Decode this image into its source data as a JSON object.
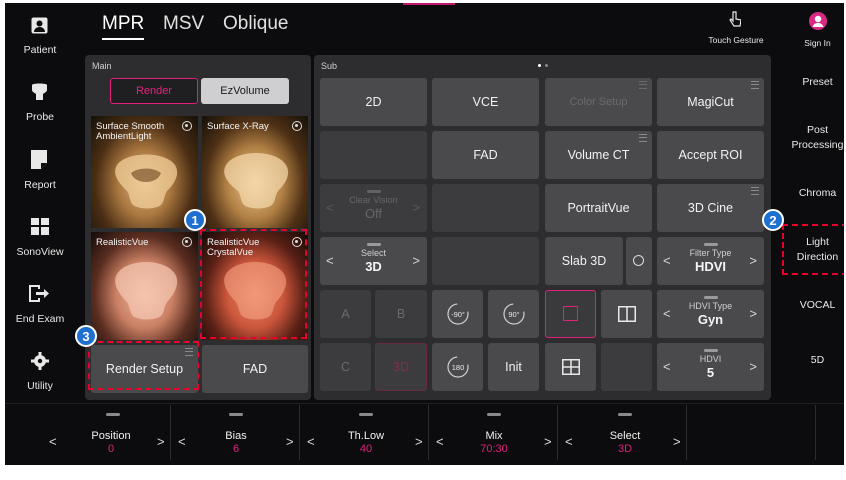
{
  "tabs": [
    "MPR",
    "MSV",
    "Oblique"
  ],
  "left_nav": [
    {
      "label": "Patient",
      "icon": "patient-icon"
    },
    {
      "label": "Probe",
      "icon": "probe-icon"
    },
    {
      "label": "Report",
      "icon": "report-icon"
    },
    {
      "label": "SonoView",
      "icon": "sonoview-icon"
    },
    {
      "label": "End Exam",
      "icon": "end-exam-icon"
    },
    {
      "label": "Utility",
      "icon": "gear-icon"
    }
  ],
  "top_right": {
    "touch_gesture": "Touch Gesture",
    "sign_in": "Sign In"
  },
  "right_menu": [
    "Preset",
    "Post Processing",
    "Chroma",
    "Light Direction",
    "VOCAL",
    "5D"
  ],
  "main_panel": {
    "title": "Main",
    "render_label": "Render",
    "ezvolume_label": "EzVolume",
    "thumbnails": [
      {
        "name": "Surface Smooth AmbientLight"
      },
      {
        "name": "Surface X-Ray"
      },
      {
        "name": "RealisticVue"
      },
      {
        "name": "RealisticVue CrystalVue"
      }
    ],
    "render_setup_label": "Render Setup",
    "fad_label": "FAD"
  },
  "sub_panel": {
    "title": "Sub",
    "buttons": {
      "b2d": "2D",
      "vce": "VCE",
      "color_setup": "Color Setup",
      "magicut": "MagiCut",
      "fad": "FAD",
      "volume_ct": "Volume CT",
      "accept_roi": "Accept ROI",
      "portraitvue": "PortraitVue",
      "cine3d": "3D Cine",
      "slab3d": "Slab 3D",
      "a": "A",
      "b": "B",
      "c": "C",
      "d3": "3D",
      "init": "Init"
    },
    "rotate": {
      "minus90": "-90°",
      "plus90": "90°",
      "r180": "180"
    },
    "clear_vision": {
      "label": "Clear Vision",
      "value": "Off"
    },
    "select": {
      "label": "Select",
      "value": "3D"
    },
    "filter_type": {
      "label": "Filter Type",
      "value": "HDVI"
    },
    "hdvi_type": {
      "label": "HDVI Type",
      "value": "Gyn"
    },
    "hdvi": {
      "label": "HDVI",
      "value": "5"
    }
  },
  "bottom_bar": [
    {
      "label": "Position",
      "value": "0"
    },
    {
      "label": "Bias",
      "value": "6"
    },
    {
      "label": "Th.Low",
      "value": "40"
    },
    {
      "label": "Mix",
      "value": "70:30"
    },
    {
      "label": "Select",
      "value": "3D"
    }
  ],
  "callouts": [
    "1",
    "2",
    "3"
  ],
  "colors": {
    "accent": "#e0207a",
    "callout_blue": "#1f6fd1",
    "highlight_red": "#e8002d"
  }
}
